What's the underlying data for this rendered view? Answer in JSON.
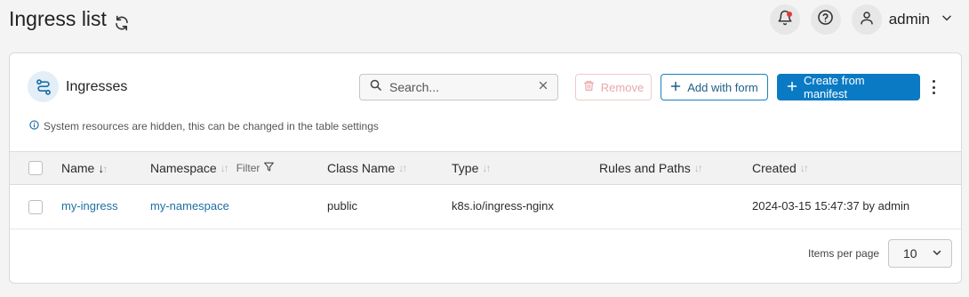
{
  "header": {
    "title": "Ingress list",
    "icons": {
      "refresh": "refresh-icon",
      "notifications": "bell-icon",
      "help": "help-icon",
      "user": "user-icon",
      "menu": "chevron-down-icon"
    },
    "user_name": "admin"
  },
  "card": {
    "title": "Ingresses",
    "icon": "ingress-route-icon",
    "search": {
      "placeholder": "Search...",
      "value": ""
    },
    "buttons": {
      "remove": "Remove",
      "add_with_form": "Add with form",
      "create_from_manifest": "Create from manifest"
    },
    "info": "System resources are hidden, this can be changed in the table settings"
  },
  "table": {
    "columns": {
      "name": "Name",
      "namespace": "Namespace",
      "filter": "Filter",
      "class_name": "Class Name",
      "type": "Type",
      "rules": "Rules and Paths",
      "created": "Created"
    },
    "rows": [
      {
        "name": "my-ingress",
        "namespace": "my-namespace",
        "class_name": "public",
        "type": "k8s.io/ingress-nginx",
        "rules": "",
        "created": "2024-03-15 15:47:37 by admin"
      }
    ]
  },
  "pagination": {
    "items_per_page_label": "Items per page",
    "items_per_page_value": "10"
  },
  "colors": {
    "primary": "#0b7ac4",
    "link": "#1d6fa6",
    "danger_light": "#e9a8a8",
    "background": "#f4f4f4"
  }
}
